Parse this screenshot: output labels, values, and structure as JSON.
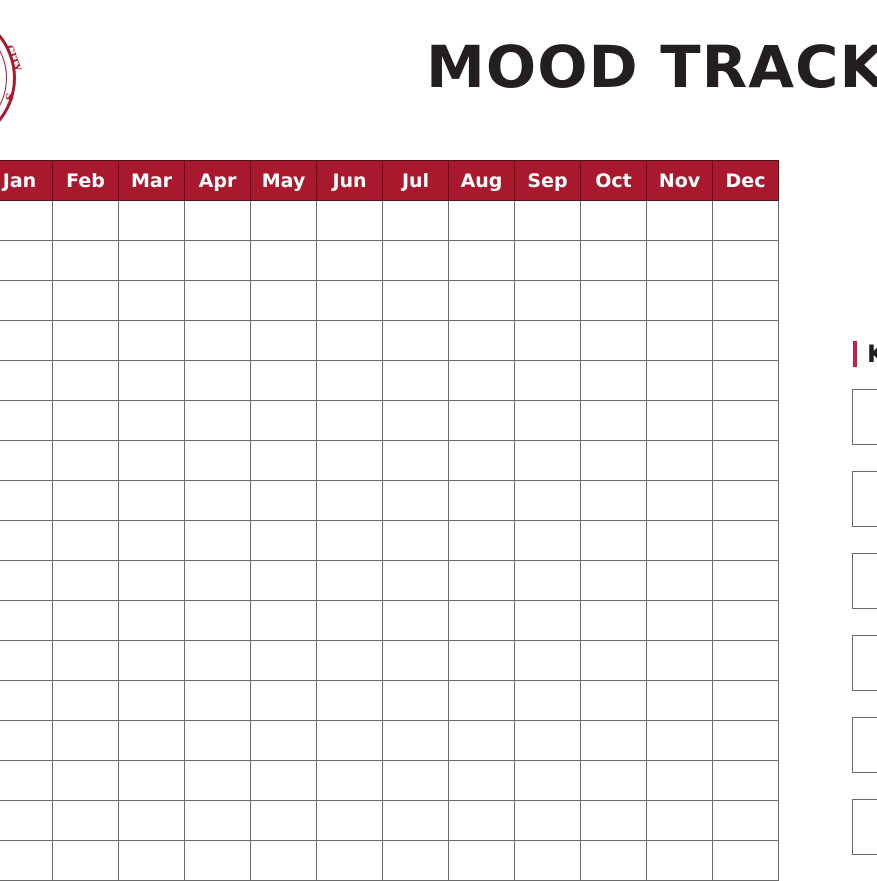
{
  "document": {
    "title": "MOOD TRACKER",
    "seal": {
      "text_fragment_1": "CITY",
      "text_fragment_2": "S",
      "color": "#a8192e"
    }
  },
  "tracker": {
    "months": [
      "Jan",
      "Feb",
      "Mar",
      "Apr",
      "May",
      "Jun",
      "Jul",
      "Aug",
      "Sep",
      "Oct",
      "Nov",
      "Dec"
    ],
    "visible_rows": 17,
    "header_color": "#a8192e",
    "cells": []
  },
  "key": {
    "heading": "KEY",
    "accent_color": "#c0223f",
    "items": [
      {
        "label": ""
      },
      {
        "label": ""
      },
      {
        "label": ""
      },
      {
        "label": ""
      },
      {
        "label": ""
      },
      {
        "label": ""
      }
    ]
  }
}
